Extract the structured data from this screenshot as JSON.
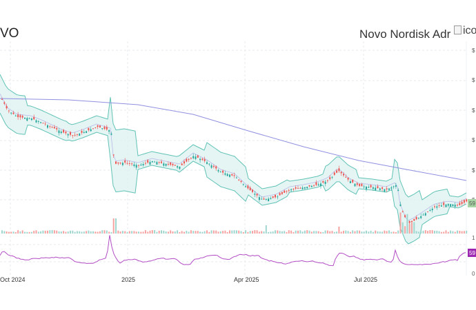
{
  "header": {
    "symbol": "VO",
    "name": "Novo Nordisk Adr",
    "logo_alt": "ico"
  },
  "colors": {
    "up": "#26a69a",
    "down": "#ef5350",
    "band_fill": "#dff3f1",
    "band_line": "#5fc2b5",
    "ma_long": "#8f8fe0",
    "rsi": "#b24bc4",
    "grid": "#e6e9ee",
    "last_price_bg": "#a8d5a4",
    "rsi_label_bg": "#9c27b0"
  },
  "price_axis": {
    "marks": [
      "$",
      "$",
      "$",
      "$",
      "$",
      "$",
      "$"
    ],
    "last_price_label": "59",
    "volume_marks": [
      "1"
    ]
  },
  "rsi_axis": {
    "value_label": "59",
    "bottom_mark": "0"
  },
  "time_axis": {
    "labels": [
      "Oct 2024",
      "2025",
      "Apr 2025",
      "Jul 2025"
    ]
  }
}
